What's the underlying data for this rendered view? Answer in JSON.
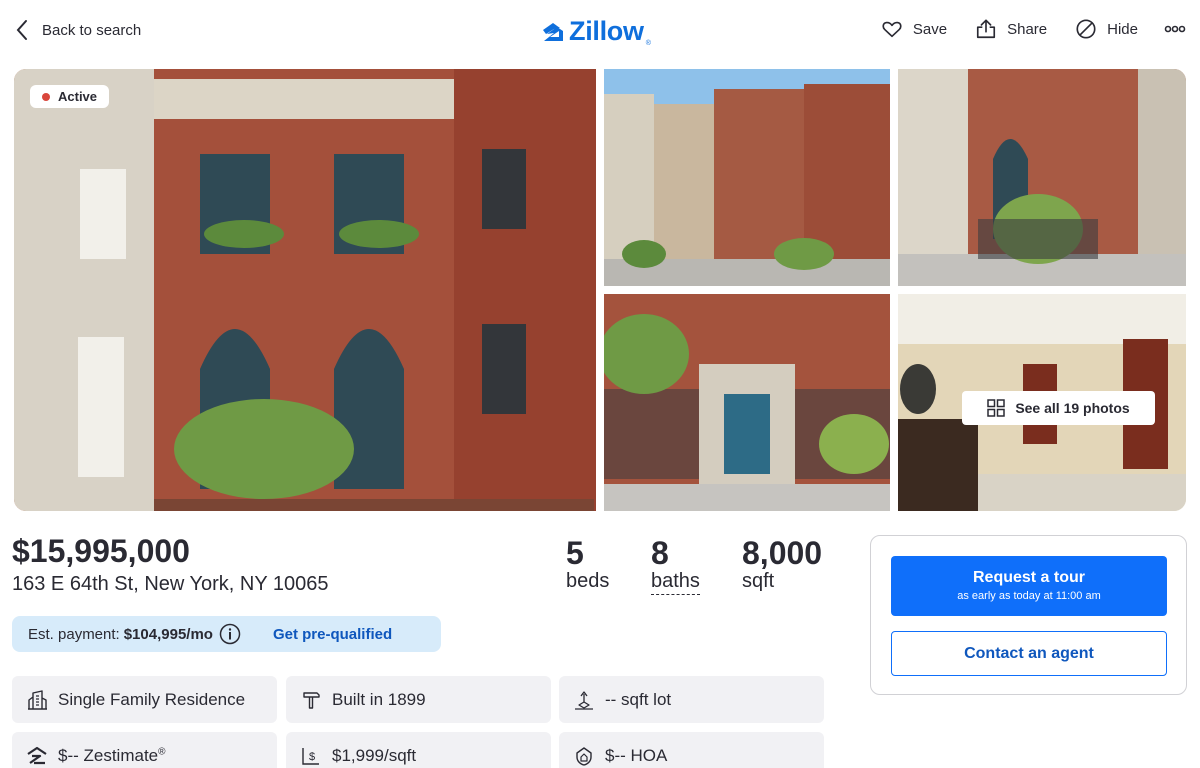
{
  "header": {
    "back_label": "Back to search",
    "logo_text": "Zillow",
    "logo_mark": "®",
    "actions": [
      {
        "label": "Save",
        "icon": "heart-icon"
      },
      {
        "label": "Share",
        "icon": "share-icon"
      },
      {
        "label": "Hide",
        "icon": "hide-icon"
      }
    ],
    "more_icon": "more-icon"
  },
  "gallery": {
    "status_badge": "Active",
    "see_all_label": "See all 19 photos"
  },
  "listing": {
    "price": "$15,995,000",
    "address": "163 E 64th St, New York, NY 10065",
    "beds": {
      "value": "5",
      "label": "beds"
    },
    "baths": {
      "value": "8",
      "label": "baths"
    },
    "sqft": {
      "value": "8,000",
      "label": "sqft"
    }
  },
  "payment": {
    "label": "Est. payment:",
    "value": "$104,995/mo",
    "cta": "Get pre-qualified"
  },
  "facts": [
    {
      "text": "Single Family Residence",
      "icon": "building-icon"
    },
    {
      "text": "Built in 1899",
      "icon": "hammer-icon"
    },
    {
      "text": "-- sqft lot",
      "icon": "lot-icon"
    },
    {
      "text": "$-- Zestimate",
      "sup": "®",
      "icon": "zestimate-icon"
    },
    {
      "text": "$1,999/sqft",
      "icon": "price-per-sqft-icon"
    },
    {
      "text": "$-- HOA",
      "icon": "hoa-icon"
    }
  ],
  "contact_card": {
    "tour_title": "Request a tour",
    "tour_subtitle": "as early as today at 11:00 am",
    "contact_label": "Contact an agent"
  },
  "colors": {
    "brand_blue": "#0f6ffa",
    "link_blue": "#0f57bd",
    "payment_bg": "#d7ebfa",
    "active_dot": "#d9463c"
  }
}
